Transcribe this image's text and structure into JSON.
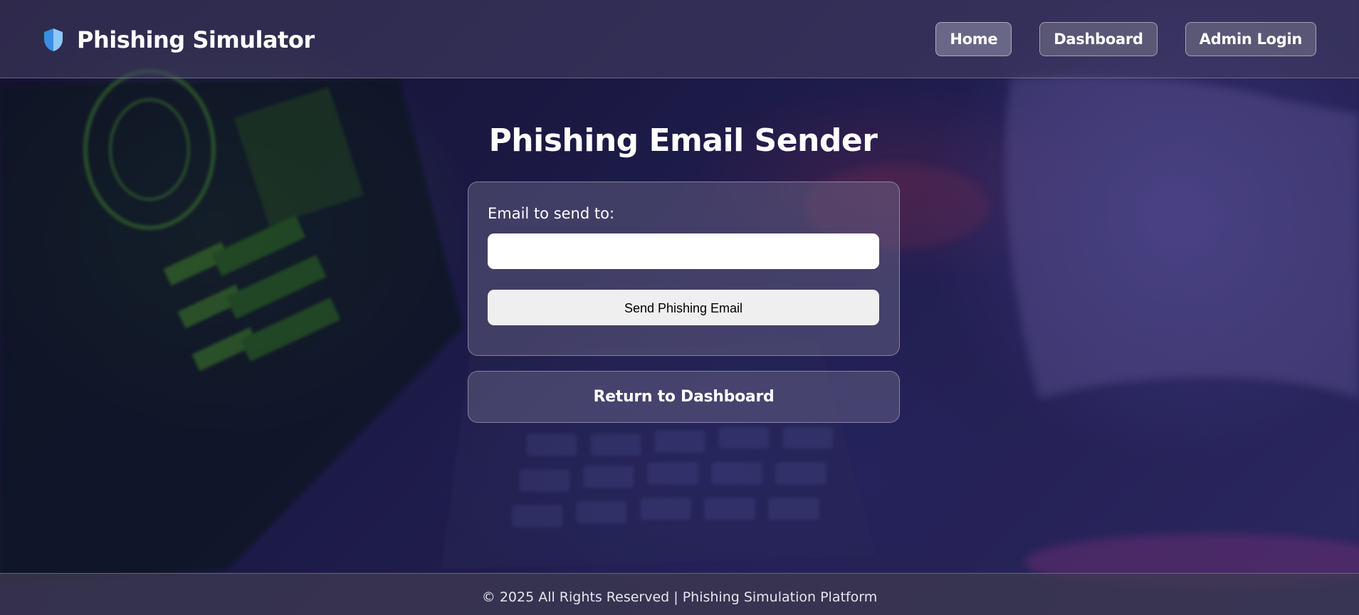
{
  "header": {
    "brand_icon": "shield-icon",
    "title": "Phishing Simulator",
    "nav": [
      {
        "label": "Home",
        "active": true
      },
      {
        "label": "Dashboard",
        "active": false
      },
      {
        "label": "Admin Login",
        "active": false
      }
    ]
  },
  "main": {
    "title": "Phishing Email Sender",
    "form": {
      "email_label": "Email to send to:",
      "email_value": "",
      "email_placeholder": "",
      "send_label": "Send Phishing Email"
    },
    "return_label": "Return to Dashboard"
  },
  "footer": {
    "text": "© 2025 All Rights Reserved | Phishing Simulation Platform"
  },
  "colors": {
    "shield_left": "#3a8ee6",
    "shield_right": "#8ec8f5",
    "accent_background": "#1c1a46"
  }
}
